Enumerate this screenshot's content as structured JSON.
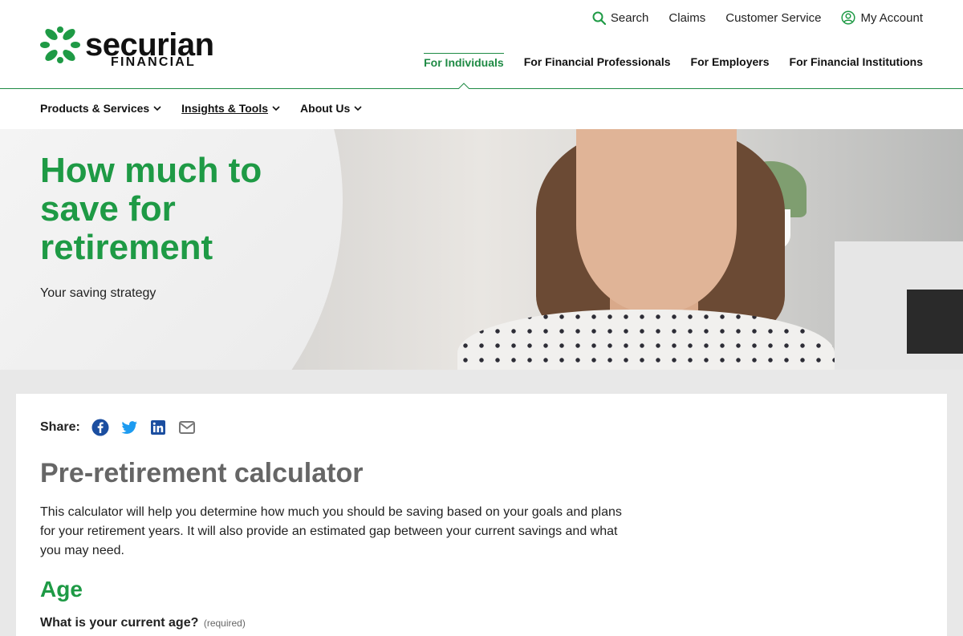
{
  "brand": {
    "name": "securian",
    "subname": "FINANCIAL",
    "green": "#1e9a45",
    "dark_green": "#1e8a44"
  },
  "utility_nav": {
    "search": "Search",
    "claims": "Claims",
    "customer_service": "Customer Service",
    "my_account": "My Account"
  },
  "audience_nav": {
    "items": [
      "For Individuals",
      "For Financial Professionals",
      "For Employers",
      "For Financial Institutions"
    ],
    "active": "For Individuals"
  },
  "sub_nav": {
    "items": [
      "Products & Services",
      "Insights & Tools",
      "About Us"
    ],
    "current": "Insights & Tools"
  },
  "hero": {
    "title": "How much to save for retirement",
    "subtitle": "Your saving strategy"
  },
  "share": {
    "label": "Share:",
    "icons": [
      "facebook-icon",
      "twitter-icon",
      "linkedin-icon",
      "email-icon"
    ]
  },
  "calculator": {
    "title": "Pre-retirement calculator",
    "description": "This calculator will help you determine how much you should be saving based on your goals and plans for your retirement years. It will also provide an estimated gap between your current savings and what you may need.",
    "section_title": "Age",
    "question": "What is your current age?",
    "required_note": "(required)"
  }
}
